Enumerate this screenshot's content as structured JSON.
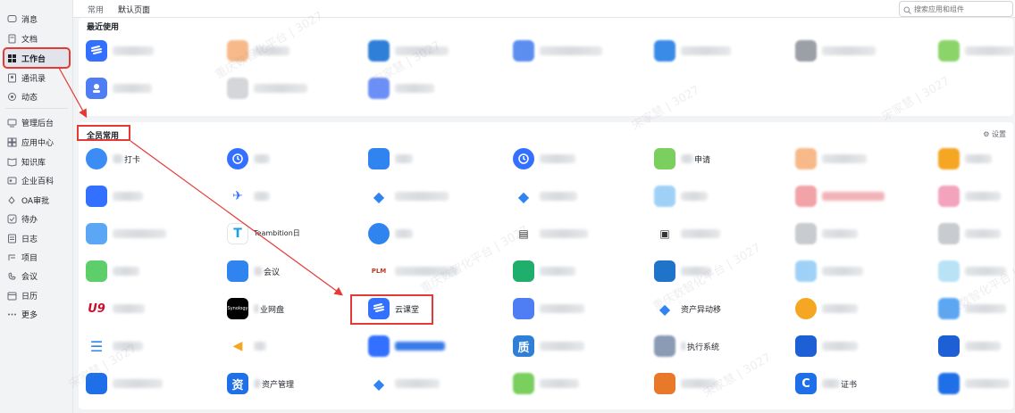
{
  "sidebar": {
    "items": [
      {
        "label": "消息",
        "icon": "message-icon"
      },
      {
        "label": "文档",
        "icon": "doc-icon"
      },
      {
        "label": "工作台",
        "icon": "workbench-icon",
        "active": true
      },
      {
        "label": "通讯录",
        "icon": "contacts-icon"
      },
      {
        "label": "动态",
        "icon": "moments-icon"
      },
      {
        "label": "管理后台",
        "icon": "admin-icon"
      },
      {
        "label": "应用中心",
        "icon": "app-center-icon"
      },
      {
        "label": "知识库",
        "icon": "knowledge-icon"
      },
      {
        "label": "企业百科",
        "icon": "wiki-icon"
      },
      {
        "label": "OA审批",
        "icon": "approval-icon"
      },
      {
        "label": "待办",
        "icon": "todo-icon"
      },
      {
        "label": "日志",
        "icon": "log-icon"
      },
      {
        "label": "项目",
        "icon": "project-icon"
      },
      {
        "label": "会议",
        "icon": "meeting-icon"
      },
      {
        "label": "日历",
        "icon": "calendar-icon"
      },
      {
        "label": "更多",
        "icon": "more-icon"
      }
    ]
  },
  "tabs": [
    {
      "label": "常用"
    },
    {
      "label": "默认页面",
      "active": true
    }
  ],
  "search": {
    "placeholder": "搜索应用和组件"
  },
  "recent": {
    "title": "最近使用"
  },
  "all": {
    "title": "全员常用",
    "settings_label": "设置"
  },
  "apps": {
    "daka": "打卡",
    "teambition": "Teambition日",
    "synology": "Synology",
    "netdisk": "业网盘",
    "yunketang": "云课堂",
    "asset_move": "资产异动移",
    "zhi": "质",
    "zhi_label": "执行系统",
    "zi": "资",
    "zi_label": "资产管理",
    "c": "C",
    "c_label": "证书",
    "approval_label": "申请",
    "meeting_label": "会议",
    "u9": "U9",
    "plm": "PLM"
  },
  "watermarks": [
    "重庆数智化平台 | 3027",
    "宋家慧 | 3027"
  ],
  "colors": {
    "accent": "#3370ff",
    "highlight": "#e53935"
  }
}
